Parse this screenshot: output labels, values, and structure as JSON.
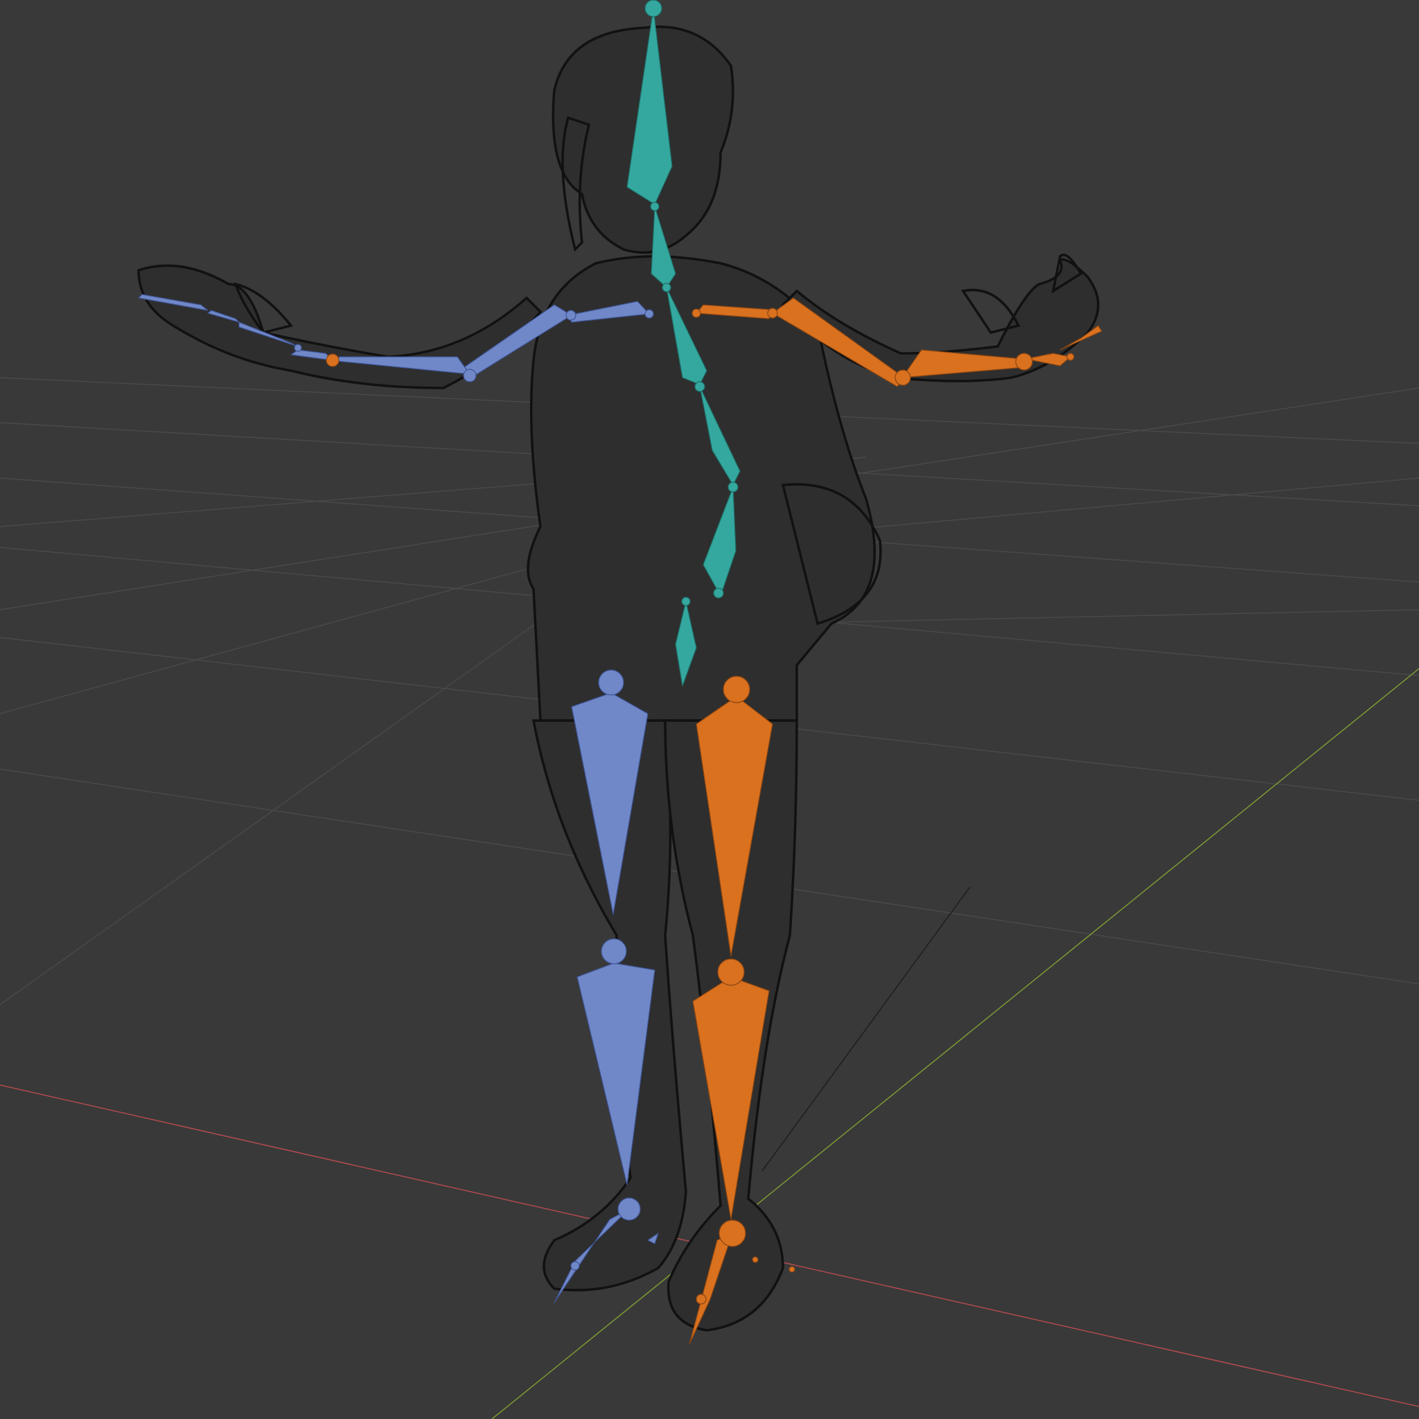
{
  "viewport": {
    "background": "#393939",
    "grid_color": "#4a4a4a",
    "axis_colors": {
      "x": "#b24a4f",
      "y": "#7c9a34",
      "z": "#1e1e1e"
    },
    "shading": "wireframe",
    "object": "armature-with-mesh"
  },
  "armature": {
    "colors": {
      "center": "#34a89f",
      "left": "#7088c8",
      "right": "#d9711f"
    },
    "groups": [
      "spine-head",
      "left-arm",
      "right-arm",
      "left-leg",
      "right-leg",
      "hips"
    ]
  }
}
